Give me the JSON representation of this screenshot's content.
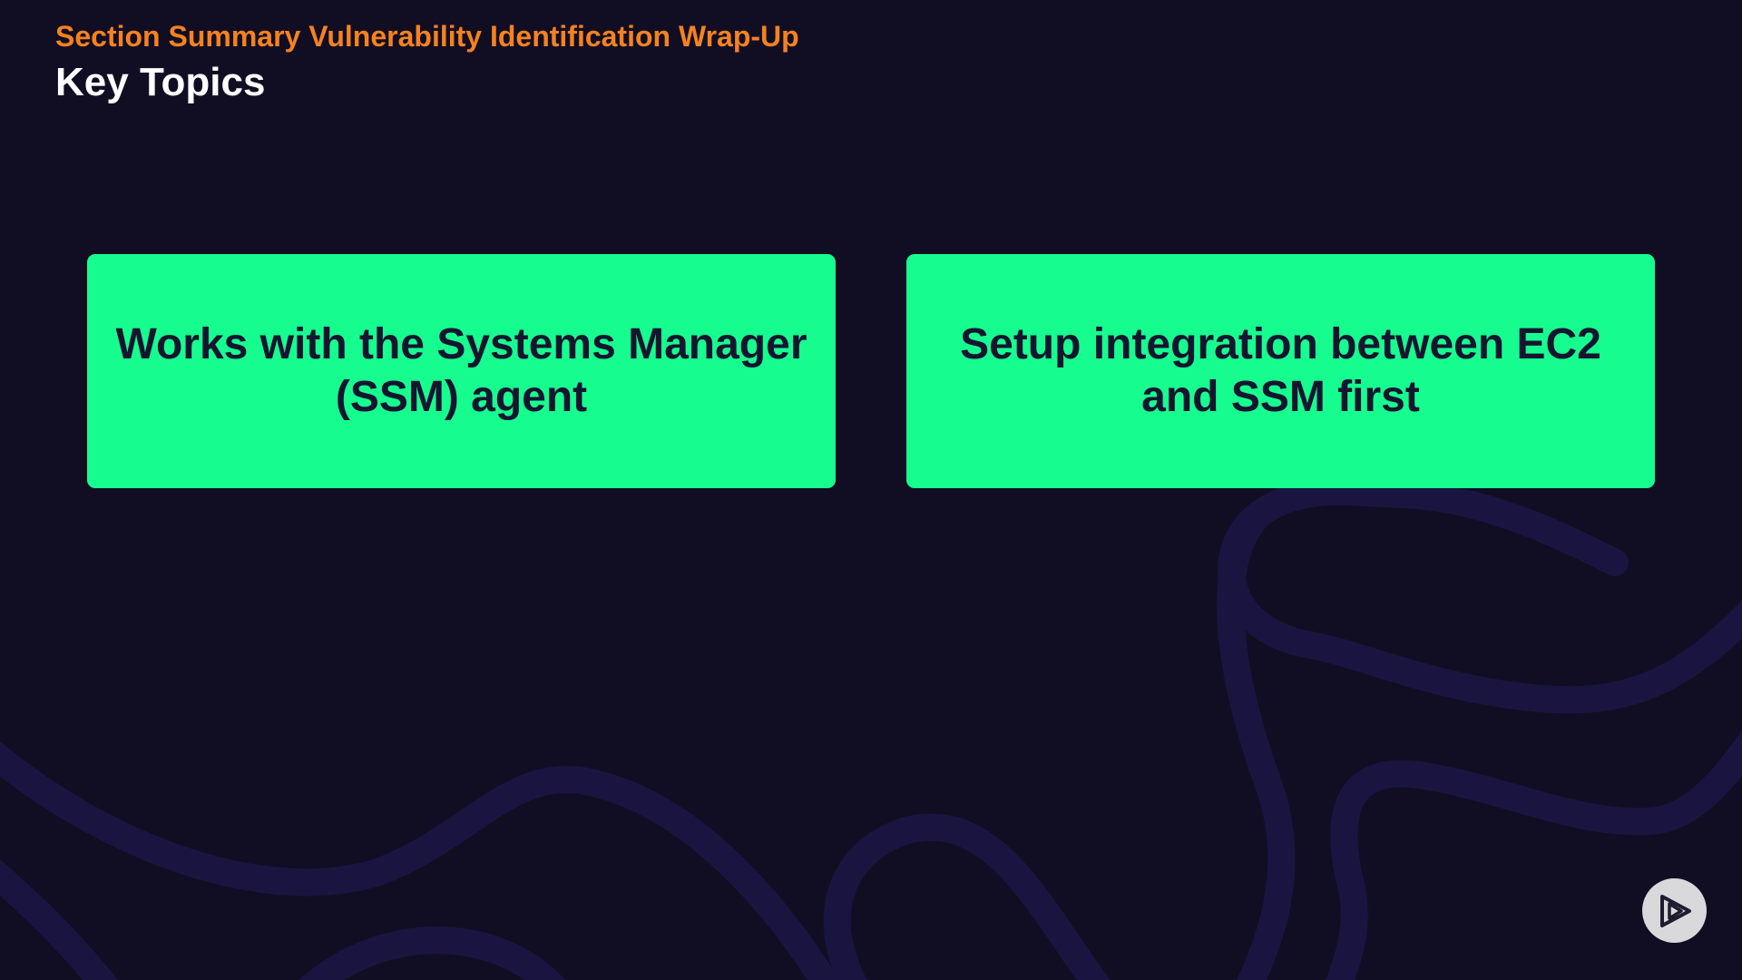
{
  "header": {
    "section_label": "Section Summary Vulnerability Identification Wrap-Up",
    "title": "Key Topics"
  },
  "topics": [
    {
      "text": "Works with the Systems Manager (SSM) agent"
    },
    {
      "text": "Setup integration between EC2 and SSM first"
    }
  ],
  "colors": {
    "background": "#110e24",
    "accent": "#f5821f",
    "card": "#17fc8f",
    "card_text": "#151530",
    "decor_curve": "#1a1540"
  },
  "icons": {
    "brand_logo": "play-logo-icon"
  }
}
